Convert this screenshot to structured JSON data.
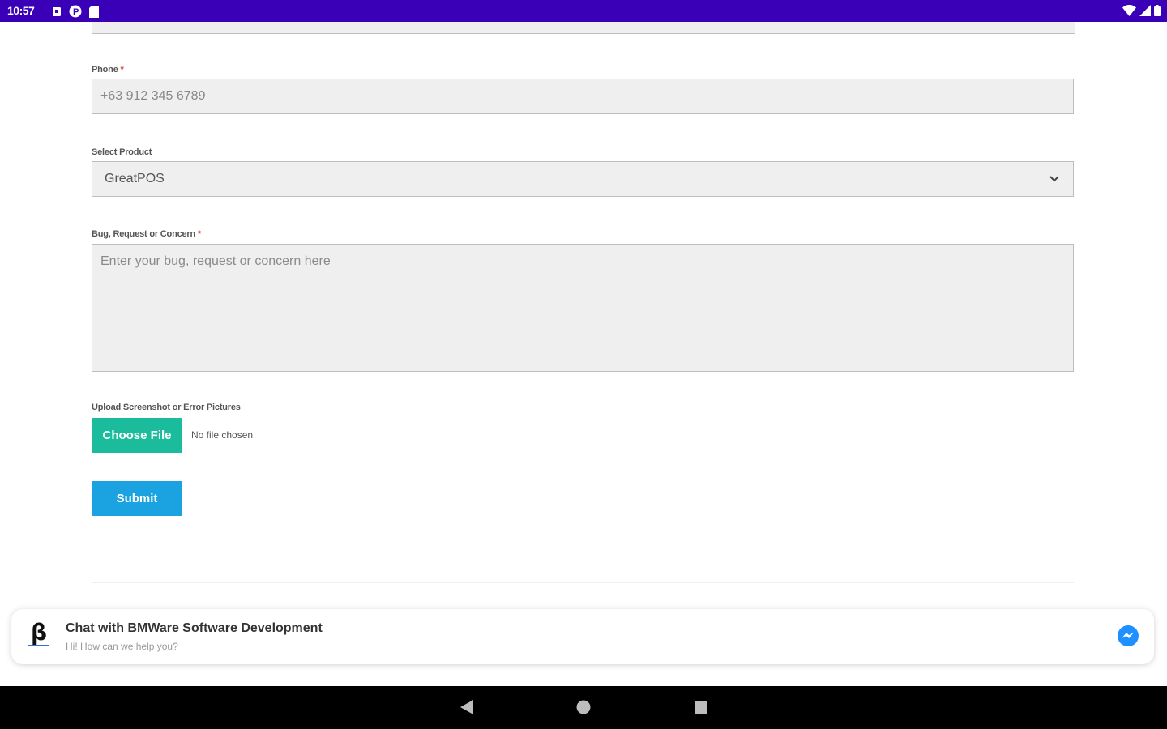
{
  "status_bar": {
    "time": "10:57"
  },
  "form": {
    "phone": {
      "label": "Phone",
      "required_mark": "*",
      "value": "+63 912 345 6789"
    },
    "product": {
      "label": "Select Product",
      "selected": "GreatPOS"
    },
    "concern": {
      "label": "Bug, Request or Concern",
      "required_mark": "*",
      "placeholder": "Enter your bug, request or concern here"
    },
    "upload": {
      "label": "Upload Screenshot or Error Pictures",
      "button_label": "Choose File",
      "status": "No file chosen"
    },
    "submit_label": "Submit"
  },
  "chat_widget": {
    "title": "Chat with BMWare Software Development",
    "subtitle": "Hi! How can we help you?",
    "logo_glyph": "β"
  },
  "colors": {
    "status_bar": "#3a00b8",
    "choose_file": "#1abc9c",
    "submit": "#1aa3e0",
    "messenger": "#1e90ff"
  }
}
